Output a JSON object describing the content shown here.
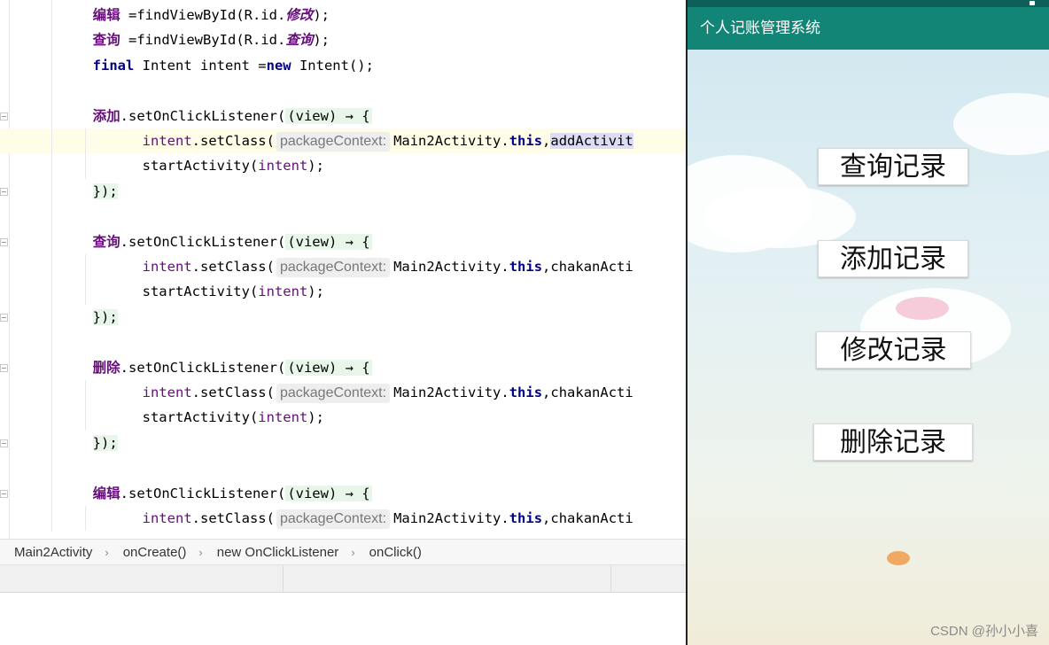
{
  "editor": {
    "lines": [
      {
        "segments": [
          {
            "t": "        ",
            "c": ""
          },
          {
            "t": "编辑",
            "c": "cn"
          },
          {
            "t": " =findViewById(R.id.",
            "c": ""
          },
          {
            "t": "修改",
            "c": "cn-italic"
          },
          {
            "t": ");",
            "c": ""
          }
        ]
      },
      {
        "segments": [
          {
            "t": "        ",
            "c": ""
          },
          {
            "t": "查询",
            "c": "cn"
          },
          {
            "t": " =findViewById(R.id.",
            "c": ""
          },
          {
            "t": "查询",
            "c": "cn-italic"
          },
          {
            "t": ");",
            "c": ""
          }
        ]
      },
      {
        "segments": [
          {
            "t": "        ",
            "c": ""
          },
          {
            "t": "final",
            "c": "kw"
          },
          {
            "t": " Intent intent =",
            "c": ""
          },
          {
            "t": "new",
            "c": "kw"
          },
          {
            "t": " Intent();",
            "c": ""
          }
        ]
      },
      {
        "segments": []
      },
      {
        "segments": [
          {
            "t": "        ",
            "c": ""
          },
          {
            "t": "添加",
            "c": "cn"
          },
          {
            "t": ".setOnClickListener(",
            "c": ""
          },
          {
            "t": "(view) → {",
            "c": "lambda"
          }
        ]
      },
      {
        "current": true,
        "segments": [
          {
            "t": "              ",
            "c": ""
          },
          {
            "t": "intent",
            "c": "fld"
          },
          {
            "t": ".setClass(",
            "c": ""
          },
          {
            "t": "packageContext:",
            "c": "hint"
          },
          {
            "t": "Main2Activity.",
            "c": ""
          },
          {
            "t": "this",
            "c": "kw"
          },
          {
            "t": ",",
            "c": ""
          },
          {
            "t": "addActivit",
            "c": "sel"
          }
        ]
      },
      {
        "segments": [
          {
            "t": "              startActivity(",
            "c": ""
          },
          {
            "t": "intent",
            "c": "fld"
          },
          {
            "t": ");",
            "c": ""
          }
        ]
      },
      {
        "segments": [
          {
            "t": "        ",
            "c": ""
          },
          {
            "t": "});",
            "c": "brace"
          }
        ]
      },
      {
        "segments": []
      },
      {
        "segments": [
          {
            "t": "        ",
            "c": ""
          },
          {
            "t": "查询",
            "c": "cn"
          },
          {
            "t": ".setOnClickListener(",
            "c": ""
          },
          {
            "t": "(view) → {",
            "c": "lambda"
          }
        ]
      },
      {
        "segments": [
          {
            "t": "              ",
            "c": ""
          },
          {
            "t": "intent",
            "c": "fld"
          },
          {
            "t": ".setClass(",
            "c": ""
          },
          {
            "t": "packageContext:",
            "c": "hint"
          },
          {
            "t": "Main2Activity.",
            "c": ""
          },
          {
            "t": "this",
            "c": "kw"
          },
          {
            "t": ",chakanActi",
            "c": ""
          }
        ]
      },
      {
        "segments": [
          {
            "t": "              startActivity(",
            "c": ""
          },
          {
            "t": "intent",
            "c": "fld"
          },
          {
            "t": ");",
            "c": ""
          }
        ]
      },
      {
        "segments": [
          {
            "t": "        ",
            "c": ""
          },
          {
            "t": "});",
            "c": "brace"
          }
        ]
      },
      {
        "segments": []
      },
      {
        "segments": [
          {
            "t": "        ",
            "c": ""
          },
          {
            "t": "删除",
            "c": "cn"
          },
          {
            "t": ".setOnClickListener(",
            "c": ""
          },
          {
            "t": "(view) → {",
            "c": "lambda"
          }
        ]
      },
      {
        "segments": [
          {
            "t": "              ",
            "c": ""
          },
          {
            "t": "intent",
            "c": "fld"
          },
          {
            "t": ".setClass(",
            "c": ""
          },
          {
            "t": "packageContext:",
            "c": "hint"
          },
          {
            "t": "Main2Activity.",
            "c": ""
          },
          {
            "t": "this",
            "c": "kw"
          },
          {
            "t": ",chakanActi",
            "c": ""
          }
        ]
      },
      {
        "segments": [
          {
            "t": "              startActivity(",
            "c": ""
          },
          {
            "t": "intent",
            "c": "fld"
          },
          {
            "t": ");",
            "c": ""
          }
        ]
      },
      {
        "segments": [
          {
            "t": "        ",
            "c": ""
          },
          {
            "t": "});",
            "c": "brace"
          }
        ]
      },
      {
        "segments": []
      },
      {
        "segments": [
          {
            "t": "        ",
            "c": ""
          },
          {
            "t": "编辑",
            "c": "cn"
          },
          {
            "t": ".setOnClickListener(",
            "c": ""
          },
          {
            "t": "(view) → {",
            "c": "lambda"
          }
        ]
      },
      {
        "segments": [
          {
            "t": "              ",
            "c": ""
          },
          {
            "t": "intent",
            "c": "fld"
          },
          {
            "t": ".setClass(",
            "c": ""
          },
          {
            "t": "packageContext:",
            "c": "hint"
          },
          {
            "t": "Main2Activity.",
            "c": ""
          },
          {
            "t": "this",
            "c": "kw"
          },
          {
            "t": ",chakanActi",
            "c": ""
          }
        ]
      }
    ]
  },
  "breadcrumbs": [
    "Main2Activity",
    "onCreate()",
    "new OnClickListener",
    "onClick()"
  ],
  "phone": {
    "app_title": "个人记账管理系统",
    "buttons": [
      {
        "label": "查询记录",
        "name": "query-records-button"
      },
      {
        "label": "添加记录",
        "name": "add-record-button"
      },
      {
        "label": "修改记录",
        "name": "edit-record-button"
      },
      {
        "label": "删除记录",
        "name": "delete-record-button"
      }
    ]
  },
  "watermark": "CSDN @孙小小喜",
  "colors": {
    "app_bar": "#138576",
    "status_bar": "#0d5f58",
    "keyword": "#000080",
    "field": "#660e7a"
  }
}
